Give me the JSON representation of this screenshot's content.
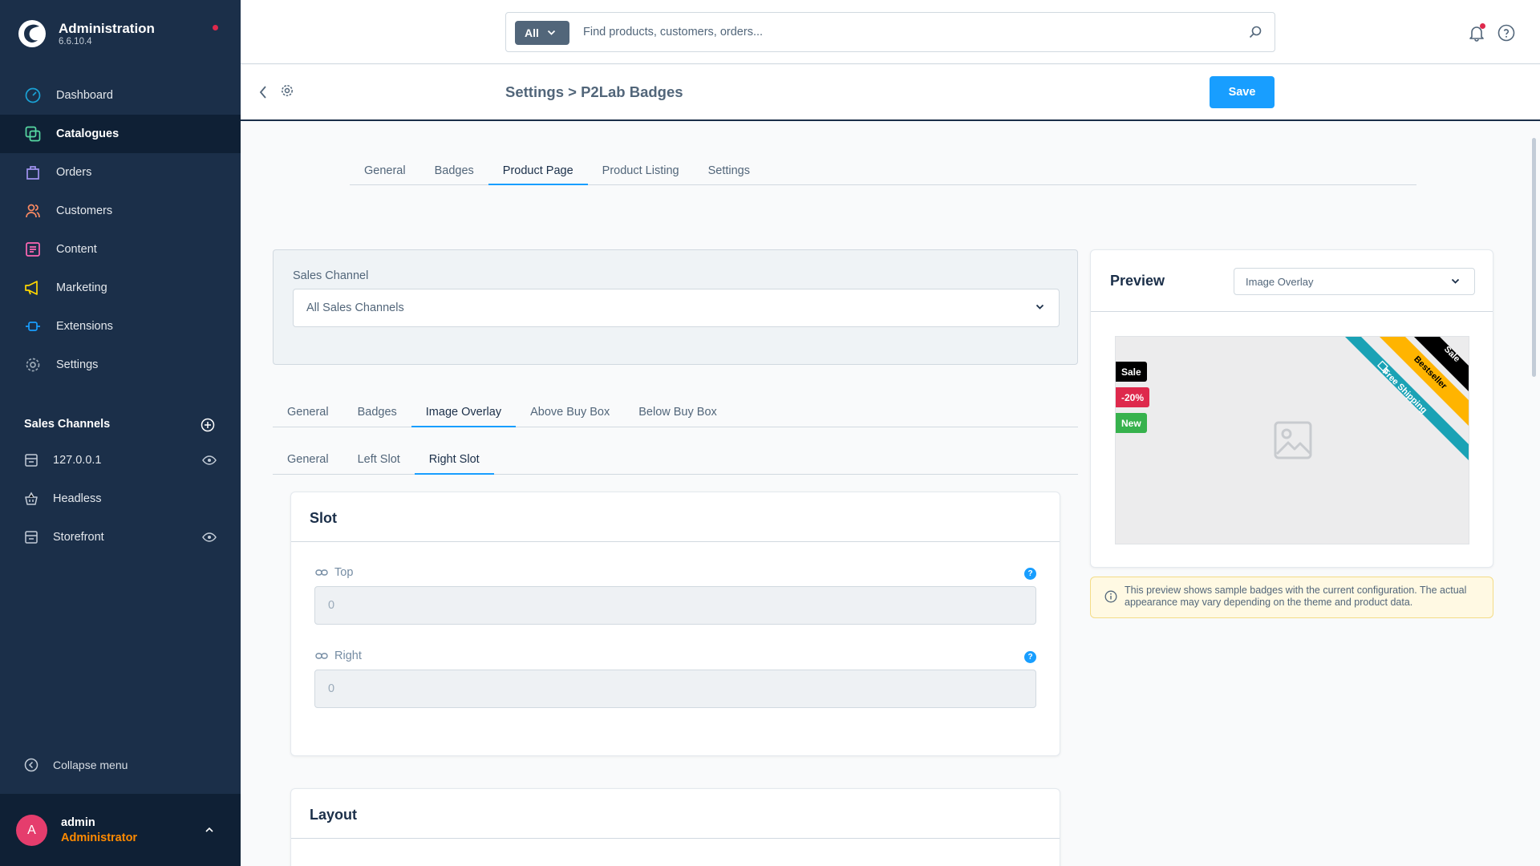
{
  "app": {
    "title": "Administration",
    "version": "6.6.10.4"
  },
  "sidebar": {
    "items": [
      {
        "label": "Dashboard",
        "icon": "dashboard-icon",
        "color": "#1aa2d6"
      },
      {
        "label": "Catalogues",
        "icon": "catalogue-icon",
        "color": "#57d9a3",
        "active": true
      },
      {
        "label": "Orders",
        "icon": "orders-icon",
        "color": "#a092f0"
      },
      {
        "label": "Customers",
        "icon": "customers-icon",
        "color": "#f88962"
      },
      {
        "label": "Content",
        "icon": "content-icon",
        "color": "#ff68b4"
      },
      {
        "label": "Marketing",
        "icon": "marketing-icon",
        "color": "#ffd700"
      },
      {
        "label": "Extensions",
        "icon": "extensions-icon",
        "color": "#189eff"
      },
      {
        "label": "Settings",
        "icon": "settings-icon",
        "color": "#9aa8b5"
      }
    ],
    "sales_channels_title": "Sales Channels",
    "sales_channels": [
      {
        "label": "127.0.0.1",
        "icon": "storefront-icon",
        "eye": true
      },
      {
        "label": "Headless",
        "icon": "basket-icon",
        "eye": false
      },
      {
        "label": "Storefront",
        "icon": "storefront-icon",
        "eye": true
      }
    ],
    "collapse_label": "Collapse menu",
    "user": {
      "initial": "A",
      "name": "admin",
      "role": "Administrator"
    }
  },
  "search": {
    "type_label": "All",
    "placeholder": "Find products, customers, orders..."
  },
  "header": {
    "title": "Settings > P2Lab Badges",
    "save_label": "Save"
  },
  "main_tabs": [
    "General",
    "Badges",
    "Product Page",
    "Product Listing",
    "Settings"
  ],
  "main_tab_active": "Product Page",
  "sales_channel": {
    "label": "Sales Channel",
    "value": "All Sales Channels"
  },
  "sub_tabs": [
    "General",
    "Badges",
    "Image Overlay",
    "Above Buy Box",
    "Below Buy Box"
  ],
  "sub_tab_active": "Image Overlay",
  "slot_tabs": [
    "General",
    "Left Slot",
    "Right Slot"
  ],
  "slot_tab_active": "Right Slot",
  "slot_card": {
    "title": "Slot",
    "fields": [
      {
        "label": "Top",
        "value": "0"
      },
      {
        "label": "Right",
        "value": "0"
      }
    ]
  },
  "layout_card": {
    "title": "Layout"
  },
  "preview": {
    "title": "Preview",
    "mode": "Image Overlay",
    "badges_left": [
      {
        "text": "Sale",
        "color": "#000000"
      },
      {
        "text": "-20%",
        "color": "#de294c"
      },
      {
        "text": "New",
        "color": "#37b24d"
      }
    ],
    "ribbons": [
      {
        "text": "Sale",
        "color": "#000000"
      },
      {
        "text": "Bestseller",
        "color": "#ffb400"
      },
      {
        "text": "Free Shipping",
        "color": "#1aa2b5"
      }
    ],
    "notice": "This preview shows sample badges with the current configuration. The actual appearance may vary depending on the theme and product data."
  }
}
